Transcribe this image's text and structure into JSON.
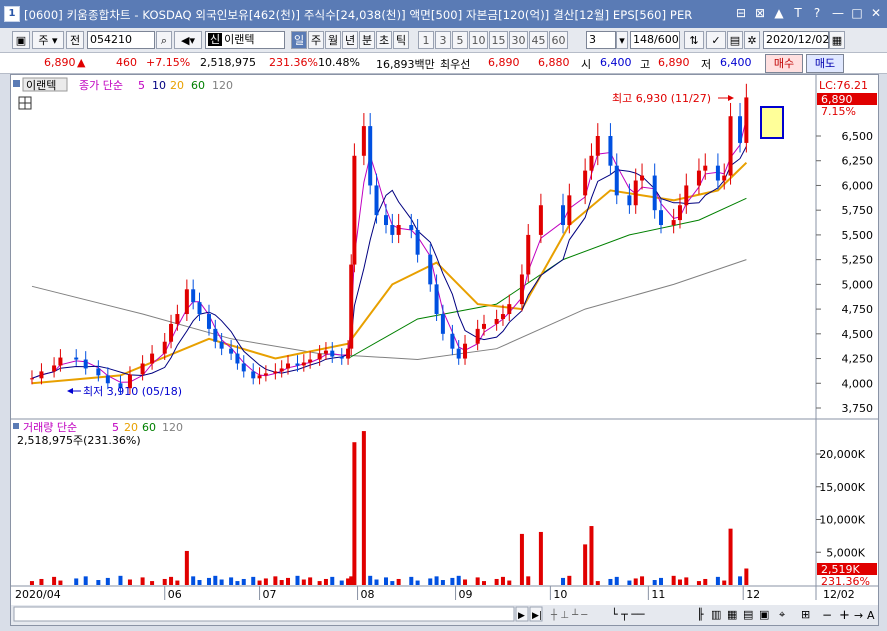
{
  "window": {
    "title": "[0600] 키움종합차트 - KOSDAQ 외국인보유[462(천)] 주식수[24,038(천)] 액면[500] 자본금[120(억)] 결산[12월] EPS[560] PER",
    "app_icon": "1"
  },
  "toolbar": {
    "type_label": "주",
    "prev_label": "전",
    "code": "054210",
    "stock_badge": "신",
    "stock_name": "이랜텍",
    "period_buttons": [
      "일",
      "주",
      "월",
      "년",
      "분",
      "초",
      "틱"
    ],
    "interval_buttons": [
      "1",
      "3",
      "5",
      "10",
      "15",
      "30",
      "45",
      "60"
    ],
    "interval_value": "3",
    "count": "148/600",
    "date": "2020/12/02"
  },
  "quote": {
    "price": "6,890",
    "arrow": "▲",
    "change": "460",
    "change_pct": "+7.15%",
    "volume": "2,518,975",
    "volume_ratio": "231.36%",
    "turnover": "10.48%",
    "amount": "16,893백만",
    "best_ask_label": "최우선",
    "best_ask": "6,890",
    "best_bid": "6,880",
    "open_label": "시",
    "open": "6,400",
    "high_label": "고",
    "high": "6,890",
    "low_label": "저",
    "low": "6,400",
    "sell_label": "매수",
    "buy_label": "매도"
  },
  "price_panel": {
    "name_tag": "이랜텍",
    "legend_prefix": "종가 단순",
    "ma_labels": [
      "5",
      "10",
      "20",
      "60",
      "120"
    ],
    "lc_label": "LC:76.21",
    "last_price_label": "6,890",
    "last_pct_label": "7.15%",
    "max_annotation": "최고 6,930 (11/27)",
    "min_annotation": "최저 3,910 (05/18)"
  },
  "volume_panel": {
    "legend_prefix": "거래량 단순",
    "ma_labels": [
      "5",
      "20",
      "60",
      "120"
    ],
    "current_label": "2,518,975주(231.36%)",
    "last_vol_label": "2,519K",
    "last_pct_label": "231.36%"
  },
  "chart_data": {
    "type": "candlestick",
    "price_axis": {
      "min": 3750,
      "max": 7150,
      "ticks": [
        3750,
        4000,
        4250,
        4500,
        4750,
        5000,
        5250,
        5500,
        5750,
        6000,
        6250,
        6500,
        7150
      ]
    },
    "price_tick_labels": [
      "3,750",
      "4,000",
      "4,250",
      "4,500",
      "4,750",
      "5,000",
      "5,250",
      "5,500",
      "5,750",
      "6,000",
      "6,250",
      "6,500"
    ],
    "volume_axis": {
      "min": 0,
      "max": 25000,
      "ticks": [
        5000,
        10000,
        15000,
        20000
      ]
    },
    "volume_tick_labels": [
      "5,000K",
      "10,000K",
      "15,000K",
      "20,000K"
    ],
    "x_labels": [
      "2020/04",
      "06",
      "07",
      "08",
      "09",
      "10",
      "11",
      "12",
      "12/02"
    ],
    "x_label_dates": [
      "2020-04",
      "2020-06",
      "2020-07",
      "2020-08",
      "2020-09",
      "2020-10",
      "2020-11",
      "2020-12",
      "2020-12-02"
    ],
    "colors": {
      "up": "#e00000",
      "down": "#0050e0",
      "ma5": "#c000c0",
      "ma10": "#000080",
      "ma20": "#e8a000",
      "ma60": "#008000",
      "ma120": "#808080"
    },
    "close_series": [
      [
        "2020-04-20",
        4050
      ],
      [
        "2020-04-23",
        4120
      ],
      [
        "2020-04-27",
        4180
      ],
      [
        "2020-04-29",
        4260
      ],
      [
        "2020-05-04",
        4240
      ],
      [
        "2020-05-07",
        4150
      ],
      [
        "2020-05-11",
        4080
      ],
      [
        "2020-05-14",
        4000
      ],
      [
        "2020-05-18",
        3950
      ],
      [
        "2020-05-21",
        4090
      ],
      [
        "2020-05-25",
        4200
      ],
      [
        "2020-05-28",
        4300
      ],
      [
        "2020-06-01",
        4420
      ],
      [
        "2020-06-03",
        4600
      ],
      [
        "2020-06-05",
        4700
      ],
      [
        "2020-06-08",
        4950
      ],
      [
        "2020-06-10",
        4820
      ],
      [
        "2020-06-12",
        4700
      ],
      [
        "2020-06-15",
        4550
      ],
      [
        "2020-06-17",
        4420
      ],
      [
        "2020-06-19",
        4350
      ],
      [
        "2020-06-22",
        4300
      ],
      [
        "2020-06-24",
        4200
      ],
      [
        "2020-06-26",
        4120
      ],
      [
        "2020-06-29",
        4050
      ],
      [
        "2020-07-01",
        4080
      ],
      [
        "2020-07-03",
        4100
      ],
      [
        "2020-07-06",
        4120
      ],
      [
        "2020-07-08",
        4150
      ],
      [
        "2020-07-10",
        4200
      ],
      [
        "2020-07-13",
        4180
      ],
      [
        "2020-07-15",
        4210
      ],
      [
        "2020-07-17",
        4240
      ],
      [
        "2020-07-20",
        4300
      ],
      [
        "2020-07-22",
        4330
      ],
      [
        "2020-07-24",
        4270
      ],
      [
        "2020-07-27",
        4250
      ],
      [
        "2020-07-29",
        4350
      ],
      [
        "2020-07-30",
        5200
      ],
      [
        "2020-07-31",
        6300
      ],
      [
        "2020-08-03",
        6600
      ],
      [
        "2020-08-05",
        6000
      ],
      [
        "2020-08-07",
        5700
      ],
      [
        "2020-08-10",
        5600
      ],
      [
        "2020-08-12",
        5500
      ],
      [
        "2020-08-14",
        5600
      ],
      [
        "2020-08-18",
        5550
      ],
      [
        "2020-08-20",
        5300
      ],
      [
        "2020-08-24",
        5000
      ],
      [
        "2020-08-26",
        4700
      ],
      [
        "2020-08-28",
        4500
      ],
      [
        "2020-08-31",
        4350
      ],
      [
        "2020-09-02",
        4250
      ],
      [
        "2020-09-04",
        4400
      ],
      [
        "2020-09-08",
        4550
      ],
      [
        "2020-09-10",
        4600
      ],
      [
        "2020-09-14",
        4650
      ],
      [
        "2020-09-16",
        4700
      ],
      [
        "2020-09-18",
        4800
      ],
      [
        "2020-09-22",
        5100
      ],
      [
        "2020-09-24",
        5500
      ],
      [
        "2020-09-28",
        5800
      ],
      [
        "2020-10-05",
        5600
      ],
      [
        "2020-10-07",
        5900
      ],
      [
        "2020-10-12",
        6150
      ],
      [
        "2020-10-14",
        6300
      ],
      [
        "2020-10-16",
        6500
      ],
      [
        "2020-10-20",
        6200
      ],
      [
        "2020-10-22",
        5900
      ],
      [
        "2020-10-26",
        5800
      ],
      [
        "2020-10-28",
        6050
      ],
      [
        "2020-10-30",
        6100
      ],
      [
        "2020-11-03",
        5750
      ],
      [
        "2020-11-05",
        5600
      ],
      [
        "2020-11-09",
        5650
      ],
      [
        "2020-11-11",
        5800
      ],
      [
        "2020-11-13",
        6000
      ],
      [
        "2020-11-17",
        6150
      ],
      [
        "2020-11-19",
        6200
      ],
      [
        "2020-11-23",
        6050
      ],
      [
        "2020-11-25",
        6100
      ],
      [
        "2020-11-27",
        6700
      ],
      [
        "2020-11-30",
        6430
      ],
      [
        "2020-12-02",
        6890
      ]
    ],
    "ma_lines": {
      "ma20": [
        [
          "2020-04-20",
          4000
        ],
        [
          "2020-05-18",
          4080
        ],
        [
          "2020-06-15",
          4450
        ],
        [
          "2020-07-06",
          4250
        ],
        [
          "2020-07-29",
          4400
        ],
        [
          "2020-08-12",
          5000
        ],
        [
          "2020-08-26",
          5220
        ],
        [
          "2020-09-08",
          4800
        ],
        [
          "2020-09-22",
          4750
        ],
        [
          "2020-10-07",
          5600
        ],
        [
          "2020-10-20",
          5950
        ],
        [
          "2020-11-09",
          5850
        ],
        [
          "2020-11-23",
          5950
        ],
        [
          "2020-12-02",
          6230
        ]
      ],
      "ma60": [
        [
          "2020-07-29",
          4250
        ],
        [
          "2020-08-20",
          4650
        ],
        [
          "2020-09-14",
          4800
        ],
        [
          "2020-10-05",
          5250
        ],
        [
          "2020-10-26",
          5500
        ],
        [
          "2020-11-17",
          5650
        ],
        [
          "2020-12-02",
          5870
        ]
      ],
      "ma120": [
        [
          "2020-04-20",
          4980
        ],
        [
          "2020-05-25",
          4700
        ],
        [
          "2020-06-22",
          4450
        ],
        [
          "2020-07-20",
          4300
        ],
        [
          "2020-08-20",
          4240
        ],
        [
          "2020-09-14",
          4350
        ],
        [
          "2020-10-12",
          4750
        ],
        [
          "2020-11-09",
          5000
        ],
        [
          "2020-12-02",
          5250
        ]
      ]
    },
    "volume_spikes": [
      [
        "2020-06-08",
        5200
      ],
      [
        "2020-07-31",
        21800
      ],
      [
        "2020-08-03",
        23500
      ],
      [
        "2020-09-22",
        7800
      ],
      [
        "2020-09-28",
        8100
      ],
      [
        "2020-10-12",
        6200
      ],
      [
        "2020-10-14",
        9000
      ],
      [
        "2020-11-27",
        8600
      ],
      [
        "2020-12-02",
        2519
      ]
    ],
    "annotations": [
      {
        "text": "최고 6,930 (11/27)",
        "date": "2020-11-27",
        "value": 6930
      },
      {
        "text": "최저 3,910 (05/18)",
        "date": "2020-05-18",
        "value": 3910
      }
    ]
  }
}
